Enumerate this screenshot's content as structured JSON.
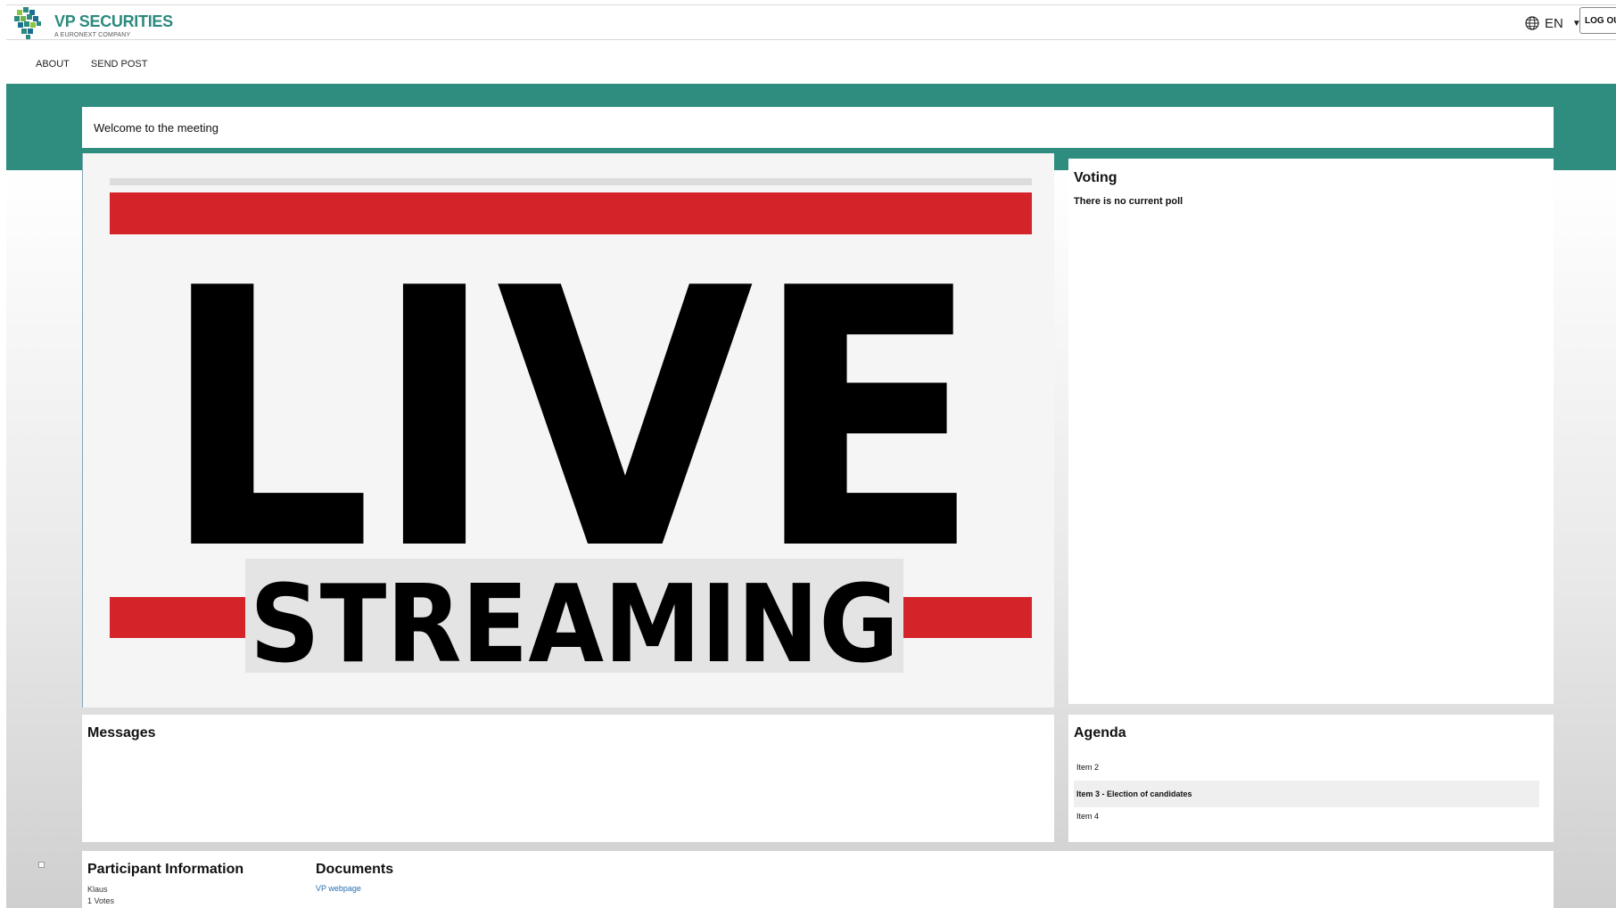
{
  "brand": {
    "name": "VP SECURITIES",
    "tagline": "A EURONEXT COMPANY",
    "color": "#2c8a7e"
  },
  "header": {
    "language": "EN",
    "language_icon": "globe-icon",
    "logout_label": "LOG OUT"
  },
  "nav": {
    "items": [
      {
        "label": "ABOUT"
      },
      {
        "label": "SEND POST"
      }
    ]
  },
  "colors": {
    "teal_band": "#2f8d7f",
    "stream_red": "#d4242a",
    "link": "#2a6fb0"
  },
  "welcome": {
    "text": "Welcome to the meeting"
  },
  "video": {
    "line1": "LIVE",
    "line2": "STREAMING"
  },
  "voting": {
    "title": "Voting",
    "message": "There is no current poll"
  },
  "messages": {
    "title": "Messages"
  },
  "agenda": {
    "title": "Agenda",
    "items": [
      {
        "label": "Item 2",
        "active": false
      },
      {
        "label": "Item 3 - Election of candidates",
        "active": true
      },
      {
        "label": "Item 4",
        "active": false
      }
    ]
  },
  "participant": {
    "title": "Participant Information",
    "name": "Klaus",
    "votes": "1 Votes"
  },
  "documents": {
    "title": "Documents",
    "links": [
      {
        "label": "VP webpage"
      }
    ]
  }
}
